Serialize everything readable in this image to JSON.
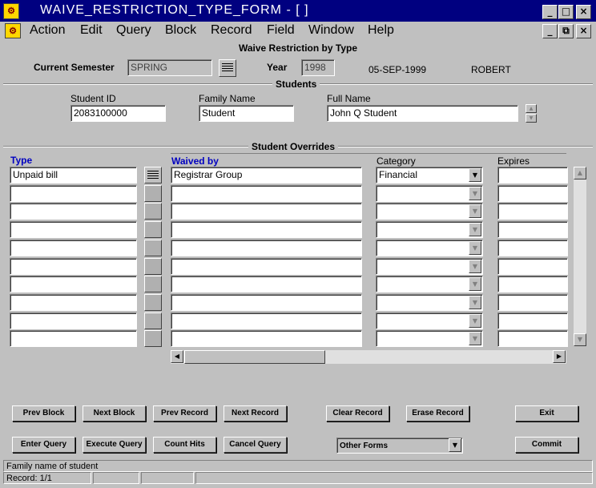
{
  "window": {
    "title": "WAIVE_RESTRICTION_TYPE_FORM - [ ]",
    "minimize_glyph": "_",
    "maximize_glyph": "□",
    "close_glyph": "×",
    "restore_glyph": "⧉"
  },
  "menu": [
    "Action",
    "Edit",
    "Query",
    "Block",
    "Record",
    "Field",
    "Window",
    "Help"
  ],
  "form": {
    "heading": "Waive Restriction by Type",
    "current_semester_label": "Current Semester",
    "current_semester_value": "SPRING",
    "year_label": "Year",
    "year_value": "1998",
    "date": "05-SEP-1999",
    "user": "ROBERT"
  },
  "students": {
    "title": "Students",
    "student_id_label": "Student ID",
    "student_id_value": "2083100000",
    "family_name_label": "Family Name",
    "family_name_value": "Student",
    "full_name_label": "Full Name",
    "full_name_value": "John Q Student"
  },
  "overrides": {
    "title": "Student Overrides",
    "type_header": "Type",
    "waived_by_header": "Waived by",
    "category_header": "Category",
    "expires_header": "Expires",
    "rows": [
      {
        "type": "Unpaid bill",
        "waived_by": "Registrar Group",
        "category": "Financial",
        "expires": ""
      },
      {
        "type": "",
        "waived_by": "",
        "category": "",
        "expires": ""
      },
      {
        "type": "",
        "waived_by": "",
        "category": "",
        "expires": ""
      },
      {
        "type": "",
        "waived_by": "",
        "category": "",
        "expires": ""
      },
      {
        "type": "",
        "waived_by": "",
        "category": "",
        "expires": ""
      },
      {
        "type": "",
        "waived_by": "",
        "category": "",
        "expires": ""
      },
      {
        "type": "",
        "waived_by": "",
        "category": "",
        "expires": ""
      },
      {
        "type": "",
        "waived_by": "",
        "category": "",
        "expires": ""
      },
      {
        "type": "",
        "waived_by": "",
        "category": "",
        "expires": ""
      },
      {
        "type": "",
        "waived_by": "",
        "category": "",
        "expires": ""
      }
    ]
  },
  "buttons": {
    "prev_block": "Prev Block",
    "next_block": "Next Block",
    "prev_record": "Prev Record",
    "next_record": "Next Record",
    "clear_record": "Clear Record",
    "erase_record": "Erase Record",
    "exit": "Exit",
    "enter_query": "Enter Query",
    "execute_query": "Execute Query",
    "count_hits": "Count Hits",
    "cancel_query": "Cancel Query",
    "other_forms": "Other Forms",
    "commit": "Commit"
  },
  "icons": {
    "app": "oracle-forms-app-icon",
    "lov": "list-of-values-icon",
    "dropdown": "chevron-down-icon"
  },
  "status": {
    "hint": "Family name of student",
    "record": "Record: 1/1"
  },
  "colors": {
    "titlebar": "#000080",
    "face": "#c0c0c0",
    "label_blue": "#0000c0"
  }
}
